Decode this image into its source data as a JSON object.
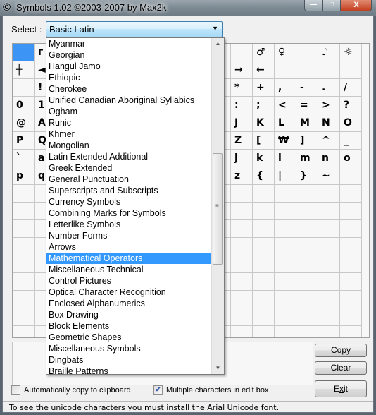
{
  "window": {
    "title": "Symbols 1.02 ©2003-2007 by Max2k",
    "app_icon": "copyright-icon",
    "app_icon_glyph": "©",
    "minimize_glyph": "—",
    "maximize_glyph": "□",
    "close_glyph": "X"
  },
  "selector": {
    "label": "Select :",
    "value": "Basic Latin",
    "arrow_glyph": "▼"
  },
  "dropdown": {
    "items": [
      "Myanmar",
      "Georgian",
      "Hangul Jamo",
      "Ethiopic",
      "Cherokee",
      "Unified Canadian Aboriginal Syllabics",
      "Ogham",
      "Runic",
      "Khmer",
      "Mongolian",
      "Latin Extended Additional",
      "Greek Extended",
      "General Punctuation",
      "Superscripts and Subscripts",
      "Currency Symbols",
      "Combining Marks for Symbols",
      "Letterlike Symbols",
      "Number Forms",
      "Arrows",
      "Mathematical Operators",
      "Miscellaneous Technical",
      "Control Pictures",
      "Optical Character Recognition",
      "Enclosed Alphanumerics",
      "Box Drawing",
      "Block Elements",
      "Geometric Shapes",
      "Miscellaneous Symbols",
      "Dingbats",
      "Braille Patterns"
    ],
    "highlighted": "Mathematical Operators",
    "scroll_up_glyph": "▲",
    "scroll_down_glyph": "▼",
    "grip_glyph": "≡"
  },
  "grid": {
    "selected_index": 0,
    "rows": [
      [
        "",
        "г",
        "",
        "",
        "",
        "",
        "",
        "",
        "",
        "",
        "",
        "♂",
        "♀",
        "",
        "♪",
        "☼"
      ],
      [
        "┼",
        "◄",
        "",
        "",
        "",
        "",
        "",
        "",
        "",
        "",
        "→",
        "←",
        "",
        "",
        "",
        ""
      ],
      [
        "",
        "!",
        "",
        "",
        "",
        "",
        "",
        "",
        "",
        "",
        "*",
        "+",
        ",",
        "-",
        ".",
        "/"
      ],
      [
        "0",
        "1",
        "",
        "",
        "",
        "",
        "",
        "",
        "",
        "",
        ":",
        ";",
        "<",
        "=",
        ">",
        "?"
      ],
      [
        "@",
        "A",
        "",
        "",
        "",
        "",
        "",
        "",
        "",
        "",
        "J",
        "K",
        "L",
        "M",
        "N",
        "O"
      ],
      [
        "P",
        "Q",
        "",
        "",
        "",
        "",
        "",
        "",
        "",
        "",
        "Z",
        "[",
        "₩",
        "]",
        "^",
        "_"
      ],
      [
        "`",
        "a",
        "",
        "",
        "",
        "",
        "",
        "",
        "",
        "",
        "j",
        "k",
        "l",
        "m",
        "n",
        "o"
      ],
      [
        "p",
        "q",
        "",
        "",
        "",
        "",
        "",
        "",
        "",
        "",
        "z",
        "{",
        "|",
        "}",
        "~",
        ""
      ],
      [
        "",
        "",
        "",
        "",
        "",
        "",
        "",
        "",
        "",
        "",
        "",
        "",
        "",
        "",
        "",
        ""
      ],
      [
        "",
        "",
        "",
        "",
        "",
        "",
        "",
        "",
        "",
        "",
        "",
        "",
        "",
        "",
        "",
        ""
      ],
      [
        "",
        "",
        "",
        "",
        "",
        "",
        "",
        "",
        "",
        "",
        "",
        "",
        "",
        "",
        "",
        ""
      ],
      [
        "",
        "",
        "",
        "",
        "",
        "",
        "",
        "",
        "",
        "",
        "",
        "",
        "",
        "",
        "",
        ""
      ],
      [
        "",
        "",
        "",
        "",
        "",
        "",
        "",
        "",
        "",
        "",
        "",
        "",
        "",
        "",
        "",
        ""
      ],
      [
        "",
        "",
        "",
        "",
        "",
        "",
        "",
        "",
        "",
        "",
        "",
        "",
        "",
        "",
        "",
        ""
      ],
      [
        "",
        "",
        "",
        "",
        "",
        "",
        "",
        "",
        "",
        "",
        "",
        "",
        "",
        "",
        "",
        ""
      ],
      [
        "",
        "",
        "",
        "",
        "",
        "",
        "",
        "",
        "",
        "",
        "",
        "",
        "",
        "",
        "",
        ""
      ],
      [
        "",
        "",
        "",
        "",
        "",
        "",
        "",
        "",
        "",
        "",
        "",
        "",
        "",
        "",
        "",
        ""
      ]
    ]
  },
  "editbox": {
    "value": ""
  },
  "buttons": {
    "copy": "Copy",
    "clear": "Clear",
    "exit": "Exit"
  },
  "options": {
    "auto_copy": {
      "label": "Automatically copy to clipboard",
      "checked": false
    },
    "multiple_chars": {
      "label": "Multiple characters in edit box",
      "checked": true,
      "check_glyph": "✔"
    }
  },
  "status": "To see the unicode characters you must install the Arial Unicode font.",
  "colors": {
    "selection": "#3399ff",
    "cell_selected": "#3c95f5"
  }
}
